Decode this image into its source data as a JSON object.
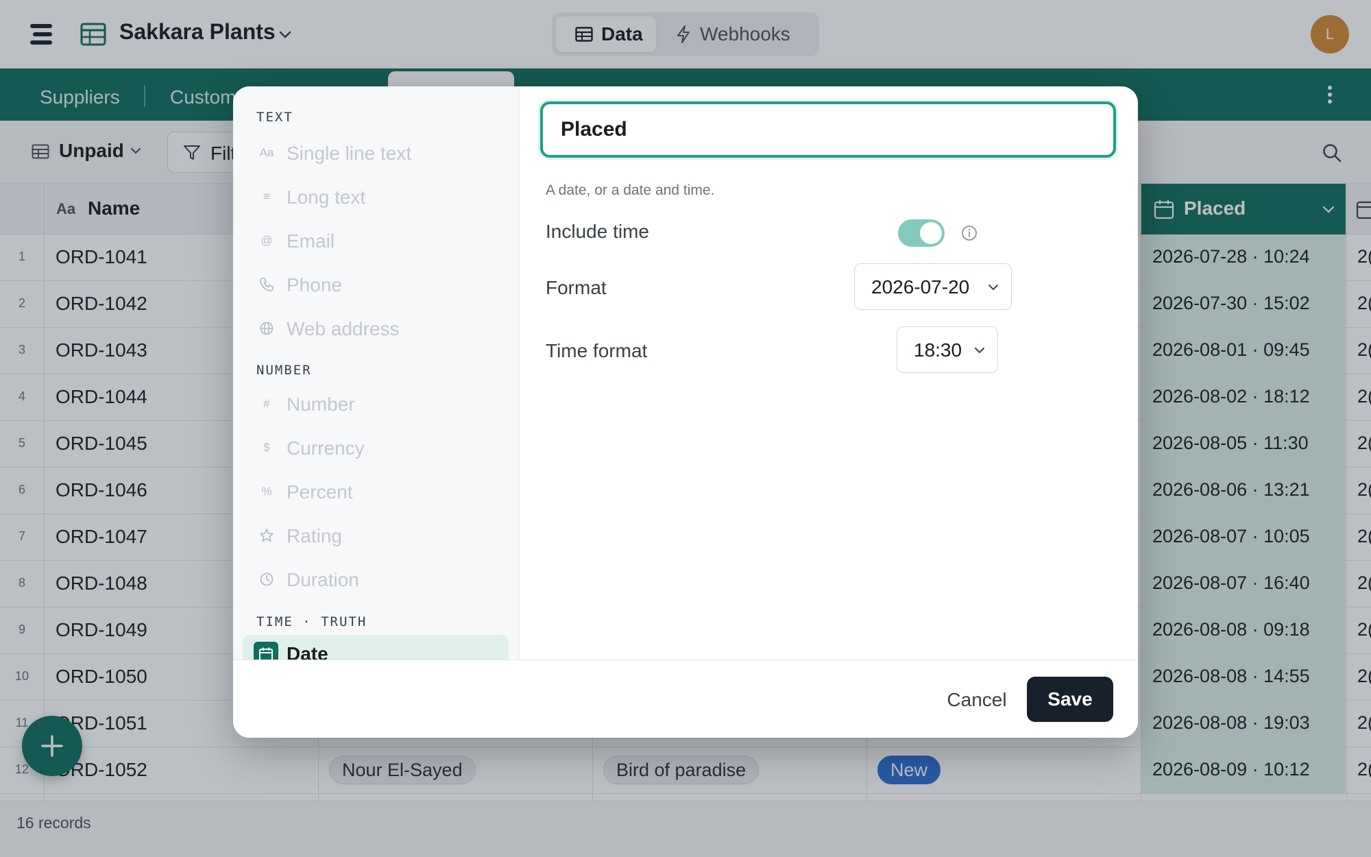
{
  "app": {
    "title": "Sakkara Plants",
    "avatar_initial": "L"
  },
  "top_tabs": [
    {
      "label": "Data",
      "active": true
    },
    {
      "label": "Webhooks",
      "active": false
    }
  ],
  "table_tabs": [
    {
      "label": "Suppliers"
    },
    {
      "label": "Custom"
    }
  ],
  "toolbar": {
    "view_name": "Unpaid",
    "filter_label": "Filt"
  },
  "grid": {
    "name_header": "Name",
    "name_header_icon": "Aa",
    "placed_header": "Placed",
    "rows": [
      {
        "num": "1",
        "name": "ORD-1041",
        "placed": "2026-07-28 · 10:24",
        "next": "2("
      },
      {
        "num": "2",
        "name": "ORD-1042",
        "placed": "2026-07-30 · 15:02",
        "next": "2("
      },
      {
        "num": "3",
        "name": "ORD-1043",
        "placed": "2026-08-01 · 09:45",
        "next": "2("
      },
      {
        "num": "4",
        "name": "ORD-1044",
        "placed": "2026-08-02 · 18:12",
        "next": "2("
      },
      {
        "num": "5",
        "name": "ORD-1045",
        "placed": "2026-08-05 · 11:30",
        "next": "2("
      },
      {
        "num": "6",
        "name": "ORD-1046",
        "placed": "2026-08-06 · 13:21",
        "next": "2("
      },
      {
        "num": "7",
        "name": "ORD-1047",
        "placed": "2026-08-07 · 10:05",
        "next": "2("
      },
      {
        "num": "8",
        "name": "ORD-1048",
        "placed": "2026-08-07 · 16:40",
        "next": "2("
      },
      {
        "num": "9",
        "name": "ORD-1049",
        "placed": "2026-08-08 · 09:18",
        "next": "2("
      },
      {
        "num": "10",
        "name": "ORD-1050",
        "placed": "2026-08-08 · 14:55",
        "next": "2("
      },
      {
        "num": "11",
        "name": "ORD-1051",
        "placed": "2026-08-08 · 19:03",
        "next": "2("
      },
      {
        "num": "12",
        "name": "ORD-1052",
        "placed": "2026-08-09 · 10:12",
        "next": "2(",
        "customer": "Nour El-Sayed",
        "product": "Bird of paradise",
        "status": "New"
      }
    ],
    "record_count": "16 records"
  },
  "modal": {
    "sections": [
      {
        "title": "TEXT",
        "items": [
          {
            "label": "Single line text",
            "icon": "Aa"
          },
          {
            "label": "Long text",
            "icon": "≡"
          },
          {
            "label": "Email",
            "icon": "@"
          },
          {
            "label": "Phone",
            "icon": "phone-icon"
          },
          {
            "label": "Web address",
            "icon": "globe-icon"
          }
        ]
      },
      {
        "title": "NUMBER",
        "items": [
          {
            "label": "Number",
            "icon": "#"
          },
          {
            "label": "Currency",
            "icon": "$"
          },
          {
            "label": "Percent",
            "icon": "%"
          },
          {
            "label": "Rating",
            "icon": "star-icon"
          },
          {
            "label": "Duration",
            "icon": "clock-icon"
          }
        ]
      },
      {
        "title": "TIME · TRUTH",
        "items": [
          {
            "label": "Date",
            "icon": "calendar-icon",
            "selected": true
          }
        ]
      }
    ],
    "field_name": "Placed",
    "description": "A date, or a date and time.",
    "include_time_label": "Include time",
    "include_time": true,
    "format_label": "Format",
    "format_value": "2026-07-20",
    "time_format_label": "Time format",
    "time_format_value": "18:30",
    "cancel_label": "Cancel",
    "save_label": "Save"
  },
  "colors": {
    "brand_green": "#0f6e5e",
    "focus_ring": "#1f9e86",
    "status_blue": "#2c6fd3",
    "avatar": "#d08a33",
    "save_button": "#17202b"
  }
}
